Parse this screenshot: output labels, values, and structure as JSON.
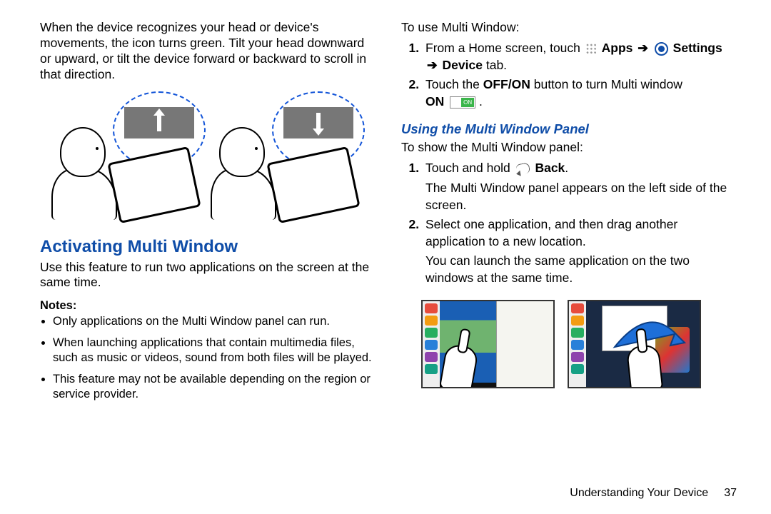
{
  "left": {
    "intro": "When the device recognizes your head or device's movements, the icon turns green. Tilt your head downward or upward, or tilt the device forward or backward to scroll in that direction.",
    "heading": "Activating Multi Window",
    "desc": "Use this feature to run two applications on the screen at the same time.",
    "notes_label": "Notes:",
    "notes": [
      "Only applications on the Multi Window panel can run.",
      "When launching applications that contain multimedia files, such as music or videos, sound from both files will be played.",
      "This feature may not be available depending on the region or service provider."
    ]
  },
  "right": {
    "use_intro": "To use Multi Window:",
    "step1_a": "From a Home screen, touch ",
    "step1_apps": "Apps",
    "step1_settings": "Settings",
    "step1_b": " tab.",
    "step1_device": "Device",
    "step2_a": "Touch the ",
    "step2_offon": "OFF/ON",
    "step2_b": " button to turn Multi window ",
    "step2_on": "ON",
    "step2_badge": "ON",
    "subheading": "Using the Multi Window Panel",
    "show_intro": "To show the Multi Window panel:",
    "p1_a": "Touch and hold ",
    "p1_back": "Back",
    "p1_b": ".",
    "p1_res": "The Multi Window panel appears on the left side of the screen.",
    "p2": "Select one application, and then drag another application to a new location.",
    "p2_res": "You can launch the same application on the two windows at the same time."
  },
  "footer": {
    "section": "Understanding Your Device",
    "page": "37"
  }
}
